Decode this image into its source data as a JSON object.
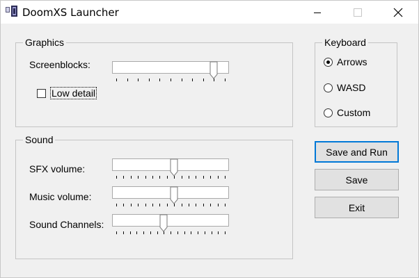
{
  "window": {
    "title": "DoomXS Launcher"
  },
  "graphics": {
    "legend": "Graphics",
    "screenblocks": {
      "label": "Screenblocks:",
      "value": 9,
      "min": 0,
      "max": 10
    },
    "low_detail": {
      "label": "Low detail",
      "checked": false
    }
  },
  "sound": {
    "legend": "Sound",
    "sfx": {
      "label": "SFX volume:",
      "value": 8,
      "min": 0,
      "max": 15
    },
    "music": {
      "label": "Music volume:",
      "value": 8,
      "min": 0,
      "max": 15
    },
    "channels": {
      "label": "Sound Channels:",
      "value": 7,
      "min": 0,
      "max": 16
    }
  },
  "keyboard": {
    "legend": "Keyboard",
    "options": [
      "Arrows",
      "WASD",
      "Custom"
    ],
    "selected": "Arrows"
  },
  "buttons": {
    "save_and_run": "Save and Run",
    "save": "Save",
    "exit": "Exit"
  },
  "colors": {
    "titlebar_bg": "#ffffff",
    "window_bg": "#f0f0f0",
    "default_button_border": "#0078d7"
  },
  "icons": {
    "app": "doom-launcher-icon",
    "minimize": "minimize-icon",
    "maximize": "maximize-icon",
    "close": "close-icon"
  }
}
